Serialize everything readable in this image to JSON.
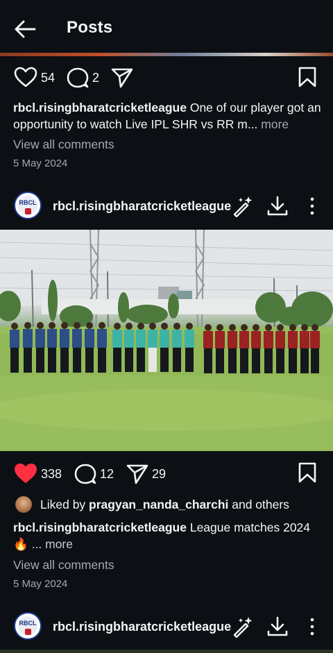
{
  "header": {
    "title": "Posts",
    "back_icon": "arrow-left-icon"
  },
  "post1": {
    "likes": "54",
    "comments": "2",
    "caption_user": "rbcl.risingbharatcricketleague",
    "caption_text": " One of our player got an opportunity to watch Live IPL SHR vs RR m...",
    "more_label": " more",
    "view_comments": "View all comments",
    "date": "5 May 2024"
  },
  "post2": {
    "avatar_text": "RBCL",
    "username": "rbcl.risingbharatcricketleague",
    "likes": "338",
    "comments": "12",
    "shares": "29",
    "liked_by_prefix": "Liked by ",
    "liked_by_user": "pragyan_nanda_charchi",
    "liked_by_suffix": " and others",
    "caption_user": "rbcl.risingbharatcricketleague",
    "caption_text": " League matches 2024",
    "caption_emoji": "🔥",
    "more_label": "... more",
    "view_comments": "View all comments",
    "date": "5 May 2024"
  },
  "post3": {
    "avatar_text": "RBCL",
    "username": "rbcl.risingbharatcricketleague"
  },
  "colors": {
    "background": "#0c0f14",
    "like_red": "#ff3040",
    "muted_text": "#a5a9b1"
  }
}
